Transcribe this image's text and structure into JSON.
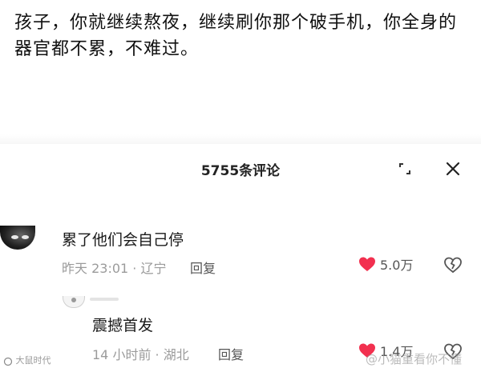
{
  "post": {
    "text": "孩子，你就继续熬夜，继续刷你那个破手机，你全身的器官都不累，不难过。"
  },
  "comments_panel": {
    "count_label": "5755条评论",
    "expand_icon": "expand-icon",
    "close_icon": "close-icon"
  },
  "comments": [
    {
      "text": "累了他们会自己停",
      "meta": "昨天 23:01 · 辽宁",
      "reply_label": "回复",
      "likes": "5.0万",
      "liked": true
    },
    {
      "text": "震撼首发",
      "meta": "14 小时前 · 湖北",
      "reply_label": "回复",
      "likes": "1.4万",
      "liked": true
    }
  ],
  "watermarks": {
    "left": "大鼠时代",
    "right": "@小猫重看你不懂"
  },
  "colors": {
    "heart": "#f2304f",
    "muted_text": "#9b9b9b"
  }
}
